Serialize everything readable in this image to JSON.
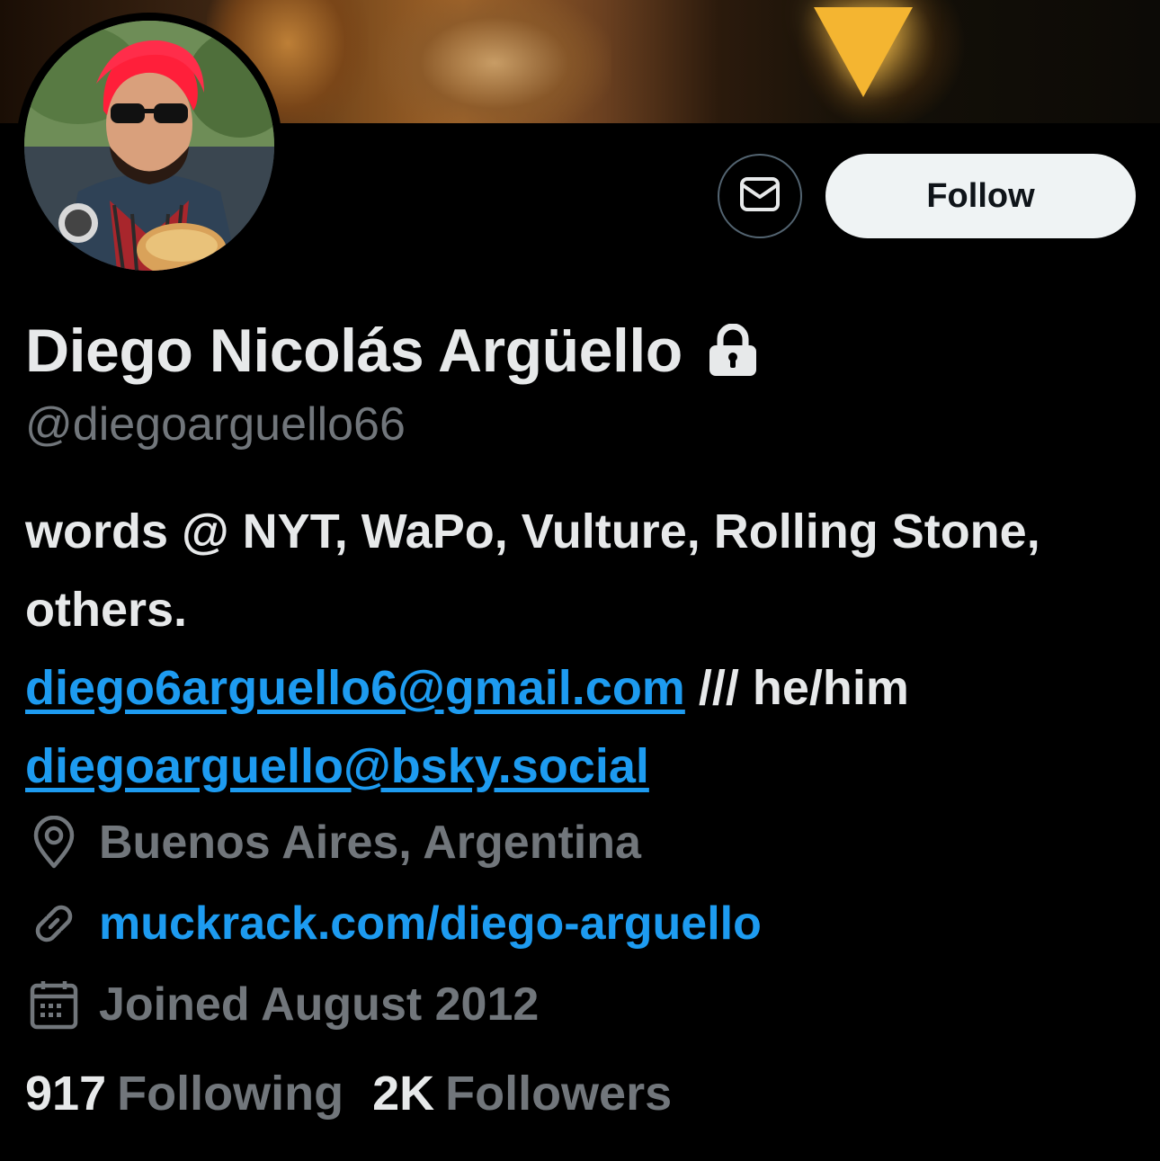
{
  "profile": {
    "display_name": "Diego Nicolás Argüello",
    "handle": "@diegoarguello66",
    "protected_icon": "lock-icon",
    "bio": {
      "line1": "words @ NYT, WaPo, Vulture, Rolling Stone, others.",
      "email_link": "diego6arguello6@gmail.com",
      "separator": " /// he/him",
      "bsky_link": "diegoarguello@bsky.social"
    },
    "location": "Buenos Aires, Argentina",
    "website": "muckrack.com/diego-arguello",
    "joined": "Joined August 2012",
    "following_count": "917",
    "following_label": "Following",
    "followers_count": "2K",
    "followers_label": "Followers"
  },
  "actions": {
    "message_icon": "mail-icon",
    "follow_label": "Follow"
  },
  "icons": {
    "location": "location-pin-icon",
    "website": "link-icon",
    "joined": "calendar-icon"
  },
  "colors": {
    "background": "#000000",
    "text_primary": "#e7e9ea",
    "text_secondary": "#71767b",
    "link": "#1d9bf0",
    "follow_button_bg": "#eff3f4"
  }
}
